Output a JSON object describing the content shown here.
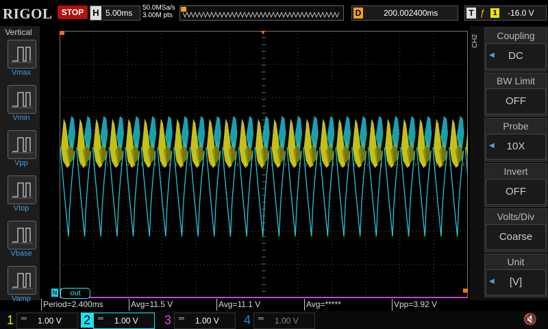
{
  "topbar": {
    "logo": "RIGOL",
    "run_state": "STOP",
    "timebase_label": "H",
    "timebase_value": "5.00ms",
    "sample_rate": "50.0MSa/s",
    "memory_depth": "3.00M pts",
    "delay_label": "D",
    "delay_value": "200.002400ms",
    "trigger_label": "T",
    "trigger_edge": "ƒ",
    "trigger_source": "1",
    "trigger_level": "-16.0 V"
  },
  "left_panel": {
    "title": "Vertical",
    "items": [
      {
        "label": "Vmax",
        "icon": "vmax-icon"
      },
      {
        "label": "Vmin",
        "icon": "vmin-icon"
      },
      {
        "label": "Vpp",
        "icon": "vpp-icon"
      },
      {
        "label": "Vtop",
        "icon": "vtop-icon"
      },
      {
        "label": "Vbase",
        "icon": "vbase-icon"
      },
      {
        "label": "Vamp",
        "icon": "vamp-icon"
      }
    ]
  },
  "right_panel": {
    "channel": "CH2",
    "items": [
      {
        "title": "Coupling",
        "value": "DC",
        "has_arrow": true
      },
      {
        "title": "BW Limit",
        "value": "OFF",
        "has_arrow": false
      },
      {
        "title": "Probe",
        "value": "10X",
        "has_arrow": true
      },
      {
        "title": "Invert",
        "value": "OFF",
        "has_arrow": false
      },
      {
        "title": "Volts/Div",
        "value": "Coarse",
        "has_arrow": false
      },
      {
        "title": "Unit",
        "value": "[V]",
        "has_arrow": true
      }
    ]
  },
  "waveform": {
    "ch1_color": "#e6e020",
    "ch2_color": "#20c8d8",
    "label": "out",
    "marker": "N"
  },
  "measurements": [
    {
      "text": "Period=2.400ms",
      "color": "yel"
    },
    {
      "text": "Avg=11.5 V",
      "color": "yel"
    },
    {
      "text": "Avg=11.1 V",
      "color": "cy"
    },
    {
      "text": "Avg=*****",
      "color": "mag"
    },
    {
      "text": "Vpp=3.92 V",
      "color": "cy"
    }
  ],
  "channels": [
    {
      "num": "1",
      "value": "1.00 V",
      "color": "#f0e020",
      "active": false
    },
    {
      "num": "2",
      "value": "1.00 V",
      "color": "#20e0f0",
      "active": true
    },
    {
      "num": "3",
      "value": "1.00 V",
      "color": "#e040e0",
      "active": false
    },
    {
      "num": "4",
      "value": "1.00 V",
      "color": "#2080e0",
      "active": false
    }
  ]
}
